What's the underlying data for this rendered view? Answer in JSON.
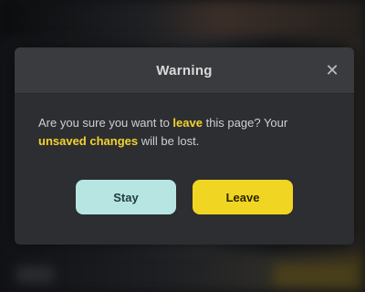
{
  "dialog": {
    "title": "Warning",
    "close_glyph": "✕",
    "message_prefix": "Are you sure you want to ",
    "message_highlight": "leave",
    "message_middle": " this page? Your ",
    "message_highlight2": "unsaved changes",
    "message_suffix": " will be lost.",
    "cancel_label": "Stay",
    "confirm_label": "Leave"
  },
  "colors": {
    "modal_bg": "#2d2e31",
    "header_bg": "#3a3b3e",
    "secondary_button": "#b7e6e2",
    "primary_button": "#f1d523",
    "highlight_text": "#f2d22e"
  },
  "icons": {
    "close": "close-icon"
  }
}
